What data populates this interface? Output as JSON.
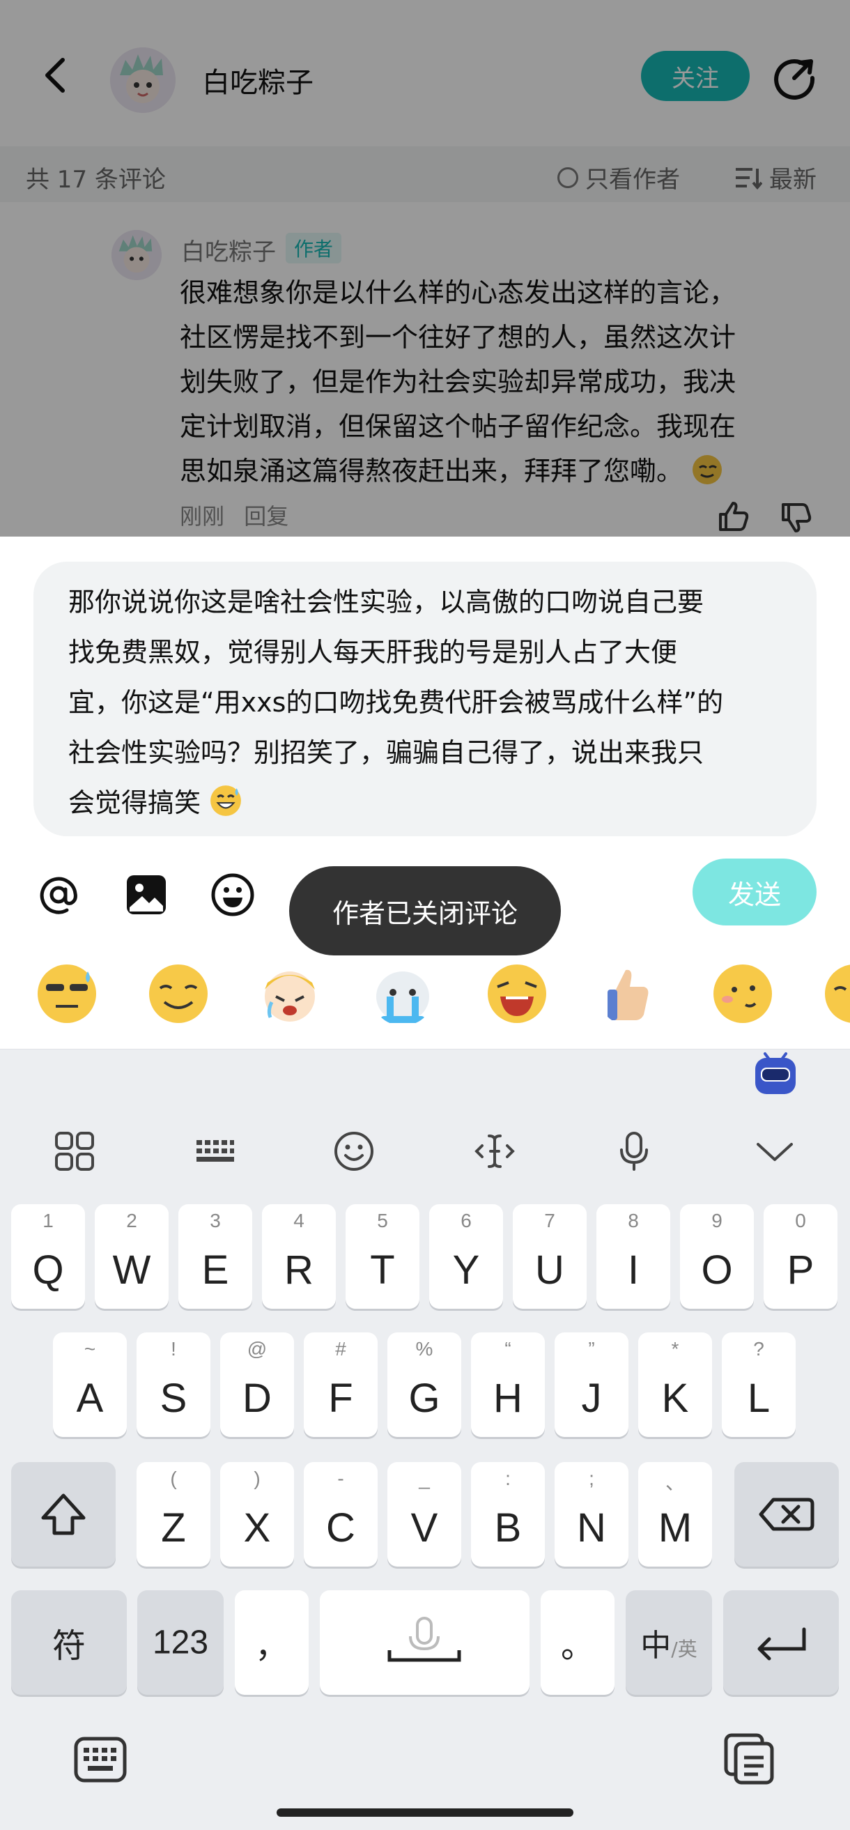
{
  "header": {
    "username": "白吃粽子",
    "follow_label": "关注"
  },
  "comments_bar": {
    "count_text": "共 17 条评论",
    "author_only_label": "只看作者",
    "sort_label": "最新"
  },
  "comment": {
    "name": "白吃粽子",
    "author_tag": "作者",
    "lines": [
      "很难想象你是以什么样的心态发出这样的言论，",
      "社区愣是找不到一个往好了想的人，虽然这次计",
      "划失败了，但是作为社会实验却异常成功，我决",
      "定计划取消，但保留这个帖子留作纪念。我现在",
      "思如泉涌这篇得熬夜赶出来，拜拜了您嘞。"
    ],
    "time": "刚刚",
    "reply_label": "回复"
  },
  "composer": {
    "lines": [
      "那你说说你这是啥社会性实验，以高傲的口吻说自己要",
      "找免费黑奴，觉得别人每天肝我的号是别人占了大便",
      "宜，你这是“用xxs的口吻找免费代肝会被骂成什么样”的",
      "社会性实验吗？别招笑了，骗骗自己得了，说出来我只",
      "会觉得搞笑"
    ],
    "send_label": "发送",
    "toast": "作者已关闭评论"
  },
  "keyboard": {
    "row1": [
      {
        "k": "Q",
        "h": "1"
      },
      {
        "k": "W",
        "h": "2"
      },
      {
        "k": "E",
        "h": "3"
      },
      {
        "k": "R",
        "h": "4"
      },
      {
        "k": "T",
        "h": "5"
      },
      {
        "k": "Y",
        "h": "6"
      },
      {
        "k": "U",
        "h": "7"
      },
      {
        "k": "I",
        "h": "8"
      },
      {
        "k": "O",
        "h": "9"
      },
      {
        "k": "P",
        "h": "0"
      }
    ],
    "row2": [
      {
        "k": "A",
        "h": "~"
      },
      {
        "k": "S",
        "h": "!"
      },
      {
        "k": "D",
        "h": "@"
      },
      {
        "k": "F",
        "h": "#"
      },
      {
        "k": "G",
        "h": "%"
      },
      {
        "k": "H",
        "h": "“"
      },
      {
        "k": "J",
        "h": "”"
      },
      {
        "k": "K",
        "h": "*"
      },
      {
        "k": "L",
        "h": "?"
      }
    ],
    "row3": [
      {
        "k": "Z",
        "h": "("
      },
      {
        "k": "X",
        "h": ")"
      },
      {
        "k": "C",
        "h": "-"
      },
      {
        "k": "V",
        "h": "_"
      },
      {
        "k": "B",
        "h": ":"
      },
      {
        "k": "N",
        "h": ";"
      },
      {
        "k": "M",
        "h": "、"
      }
    ],
    "symbol_label": "符",
    "numbers_label": "123",
    "comma_label": "，",
    "period_label": "。",
    "lang_label": "中",
    "lang_sub": "/英"
  },
  "colors": {
    "accent": "#16b8b4",
    "send_disabled": "#7de6e1",
    "toast_bg": "#333333",
    "keyboard_bg": "#eceef1"
  }
}
